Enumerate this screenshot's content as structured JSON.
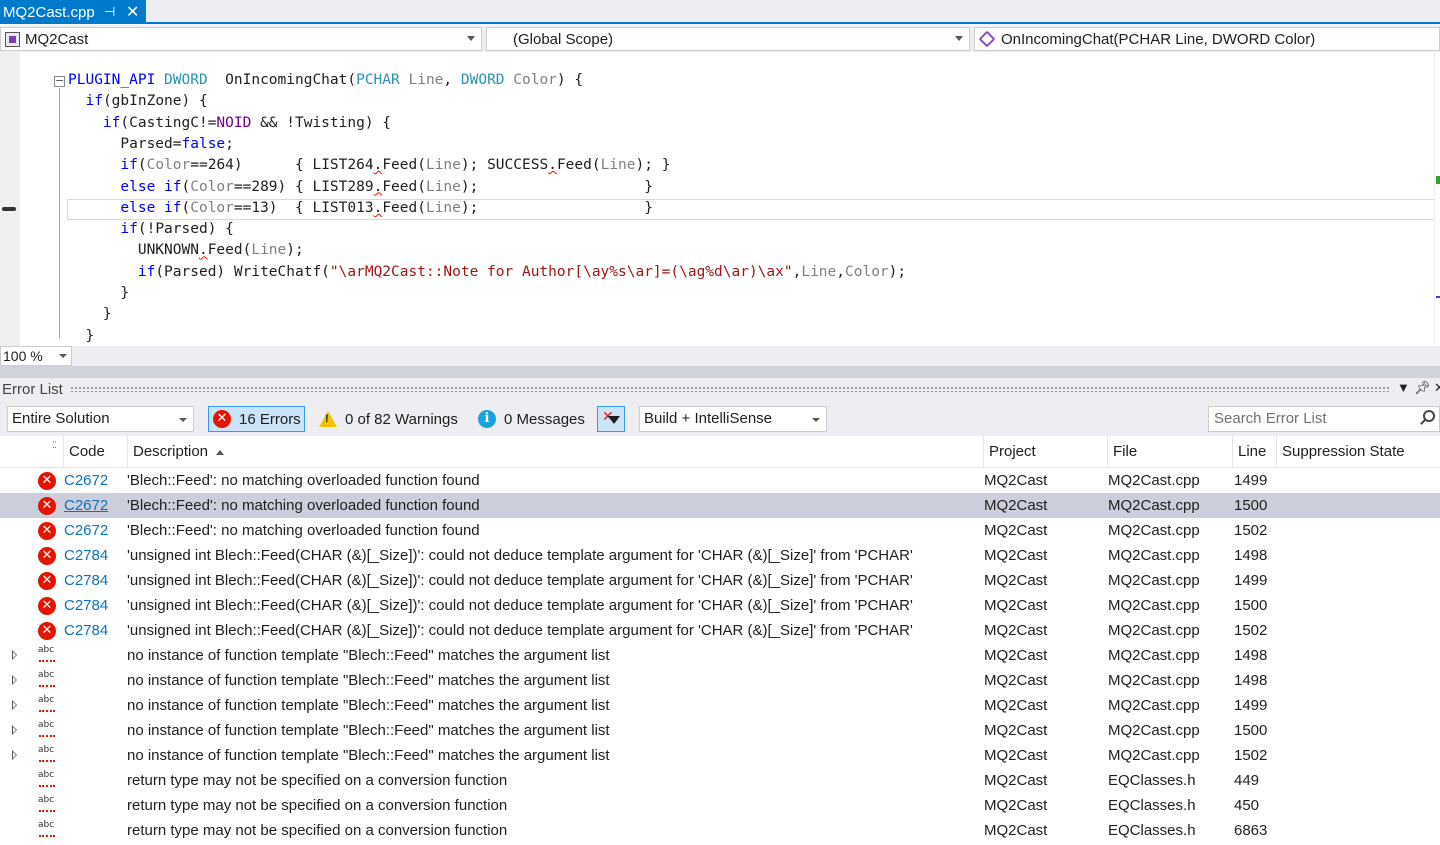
{
  "tab": {
    "title": "MQ2Cast.cpp",
    "pin": "⊣",
    "close": "✕"
  },
  "nav": {
    "project": "MQ2Cast",
    "scope": "(Global Scope)",
    "member": "OnIncomingChat(PCHAR Line, DWORD Color)"
  },
  "zoom": "100 %",
  "error_list": {
    "title": "Error List",
    "scope": "Entire Solution",
    "errors": "16 Errors",
    "warnings": "0 of 82 Warnings",
    "messages": "0 Messages",
    "build_filter": "Build + IntelliSense",
    "search_placeholder": "Search Error List",
    "columns": {
      "code": "Code",
      "description": "Description",
      "project": "Project",
      "file": "File",
      "line": "Line",
      "suppression": "Suppression State"
    },
    "rows": [
      {
        "kind": "error",
        "code": "C2672",
        "description": "'Blech::Feed': no matching overloaded function found",
        "project": "MQ2Cast",
        "file": "MQ2Cast.cpp",
        "line": "1499"
      },
      {
        "kind": "error",
        "code": "C2672",
        "description": "'Blech::Feed': no matching overloaded function found",
        "project": "MQ2Cast",
        "file": "MQ2Cast.cpp",
        "line": "1500",
        "selected": true
      },
      {
        "kind": "error",
        "code": "C2672",
        "description": "'Blech::Feed': no matching overloaded function found",
        "project": "MQ2Cast",
        "file": "MQ2Cast.cpp",
        "line": "1502"
      },
      {
        "kind": "error",
        "code": "C2784",
        "description": "'unsigned int Blech::Feed(CHAR (&)[_Size])': could not deduce template argument for 'CHAR (&)[_Size]' from 'PCHAR'",
        "project": "MQ2Cast",
        "file": "MQ2Cast.cpp",
        "line": "1498"
      },
      {
        "kind": "error",
        "code": "C2784",
        "description": "'unsigned int Blech::Feed(CHAR (&)[_Size])': could not deduce template argument for 'CHAR (&)[_Size]' from 'PCHAR'",
        "project": "MQ2Cast",
        "file": "MQ2Cast.cpp",
        "line": "1499"
      },
      {
        "kind": "error",
        "code": "C2784",
        "description": "'unsigned int Blech::Feed(CHAR (&)[_Size])': could not deduce template argument for 'CHAR (&)[_Size]' from 'PCHAR'",
        "project": "MQ2Cast",
        "file": "MQ2Cast.cpp",
        "line": "1500"
      },
      {
        "kind": "error",
        "code": "C2784",
        "description": "'unsigned int Blech::Feed(CHAR (&)[_Size])': could not deduce template argument for 'CHAR (&)[_Size]' from 'PCHAR'",
        "project": "MQ2Cast",
        "file": "MQ2Cast.cpp",
        "line": "1502"
      },
      {
        "kind": "intellisense",
        "expand": true,
        "code": "",
        "description": "no instance of function template \"Blech::Feed\" matches the argument list",
        "project": "MQ2Cast",
        "file": "MQ2Cast.cpp",
        "line": "1498"
      },
      {
        "kind": "intellisense",
        "expand": true,
        "code": "",
        "description": "no instance of function template \"Blech::Feed\" matches the argument list",
        "project": "MQ2Cast",
        "file": "MQ2Cast.cpp",
        "line": "1498"
      },
      {
        "kind": "intellisense",
        "expand": true,
        "code": "",
        "description": "no instance of function template \"Blech::Feed\" matches the argument list",
        "project": "MQ2Cast",
        "file": "MQ2Cast.cpp",
        "line": "1499"
      },
      {
        "kind": "intellisense",
        "expand": true,
        "code": "",
        "description": "no instance of function template \"Blech::Feed\" matches the argument list",
        "project": "MQ2Cast",
        "file": "MQ2Cast.cpp",
        "line": "1500"
      },
      {
        "kind": "intellisense",
        "expand": true,
        "code": "",
        "description": "no instance of function template \"Blech::Feed\" matches the argument list",
        "project": "MQ2Cast",
        "file": "MQ2Cast.cpp",
        "line": "1502"
      },
      {
        "kind": "intellisense",
        "expand": false,
        "code": "",
        "description": "return type may not be specified on a conversion function",
        "project": "MQ2Cast",
        "file": "EQClasses.h",
        "line": "449"
      },
      {
        "kind": "intellisense",
        "expand": false,
        "code": "",
        "description": "return type may not be specified on a conversion function",
        "project": "MQ2Cast",
        "file": "EQClasses.h",
        "line": "450"
      },
      {
        "kind": "intellisense",
        "expand": false,
        "code": "",
        "description": "return type may not be specified on a conversion function",
        "project": "MQ2Cast",
        "file": "EQClasses.h",
        "line": "6863"
      }
    ]
  },
  "code_lines": [
    [
      [
        "kw",
        "PLUGIN_API "
      ],
      [
        "ty",
        "DWORD"
      ],
      [
        "",
        "  OnIncomingChat("
      ],
      [
        "ty",
        "PCHAR"
      ],
      [
        "pa",
        " Line"
      ],
      [
        "",
        ", "
      ],
      [
        "ty",
        "DWORD"
      ],
      [
        "pa",
        " Color"
      ],
      [
        "",
        ") {"
      ]
    ],
    [
      [
        "",
        "  "
      ],
      [
        "kw",
        "if"
      ],
      [
        "",
        "(gbInZone) {"
      ]
    ],
    [
      [
        "",
        "    "
      ],
      [
        "kw",
        "if"
      ],
      [
        "",
        "(CastingC!="
      ],
      [
        "mac",
        "NOID"
      ],
      [
        "",
        " && !Twisting) {"
      ]
    ],
    [
      [
        "",
        "      Parsed="
      ],
      [
        "kw",
        "false"
      ],
      [
        "",
        ";"
      ]
    ],
    [
      [
        "",
        "      "
      ],
      [
        "kw",
        "if"
      ],
      [
        "",
        "("
      ],
      [
        "pa",
        "Color"
      ],
      [
        "",
        "==264)      { LIST264"
      ],
      [
        "sq",
        "."
      ],
      [
        "",
        "Feed("
      ],
      [
        "pa",
        "Line"
      ],
      [
        "",
        "); SUCCESS"
      ],
      [
        "sq",
        "."
      ],
      [
        "",
        "Feed("
      ],
      [
        "pa",
        "Line"
      ],
      [
        "",
        "); }"
      ]
    ],
    [
      [
        "",
        "      "
      ],
      [
        "kw",
        "else if"
      ],
      [
        "",
        "("
      ],
      [
        "pa",
        "Color"
      ],
      [
        "",
        "==289) { LIST289"
      ],
      [
        "sq",
        "."
      ],
      [
        "",
        "Feed("
      ],
      [
        "pa",
        "Line"
      ],
      [
        "",
        ");                   }"
      ]
    ],
    [
      [
        "",
        "      "
      ],
      [
        "kw",
        "else if"
      ],
      [
        "",
        "("
      ],
      [
        "pa",
        "Color"
      ],
      [
        "",
        "==13)  { LIST013"
      ],
      [
        "sq",
        "."
      ],
      [
        "",
        "Feed("
      ],
      [
        "pa",
        "Line"
      ],
      [
        "",
        ");                   }"
      ]
    ],
    [
      [
        "",
        "      "
      ],
      [
        "kw",
        "if"
      ],
      [
        "",
        "(!Parsed) {"
      ]
    ],
    [
      [
        "",
        "        UNKNOWN"
      ],
      [
        "sq",
        "."
      ],
      [
        "",
        "Feed("
      ],
      [
        "pa",
        "Line"
      ],
      [
        "",
        ");"
      ]
    ],
    [
      [
        "",
        "        "
      ],
      [
        "kw",
        "if"
      ],
      [
        "",
        "(Parsed) WriteChatf("
      ],
      [
        "str",
        "\"\\arMQ2Cast::Note for Author[\\ay%s\\ar]=(\\ag%d\\ar)\\ax\""
      ],
      [
        "",
        ","
      ],
      [
        "pa",
        "Line"
      ],
      [
        "",
        ","
      ],
      [
        "pa",
        "Color"
      ],
      [
        "",
        ");"
      ]
    ],
    [
      [
        "",
        "      }"
      ]
    ],
    [
      [
        "",
        "    }"
      ]
    ],
    [
      [
        "",
        "  }"
      ]
    ]
  ]
}
